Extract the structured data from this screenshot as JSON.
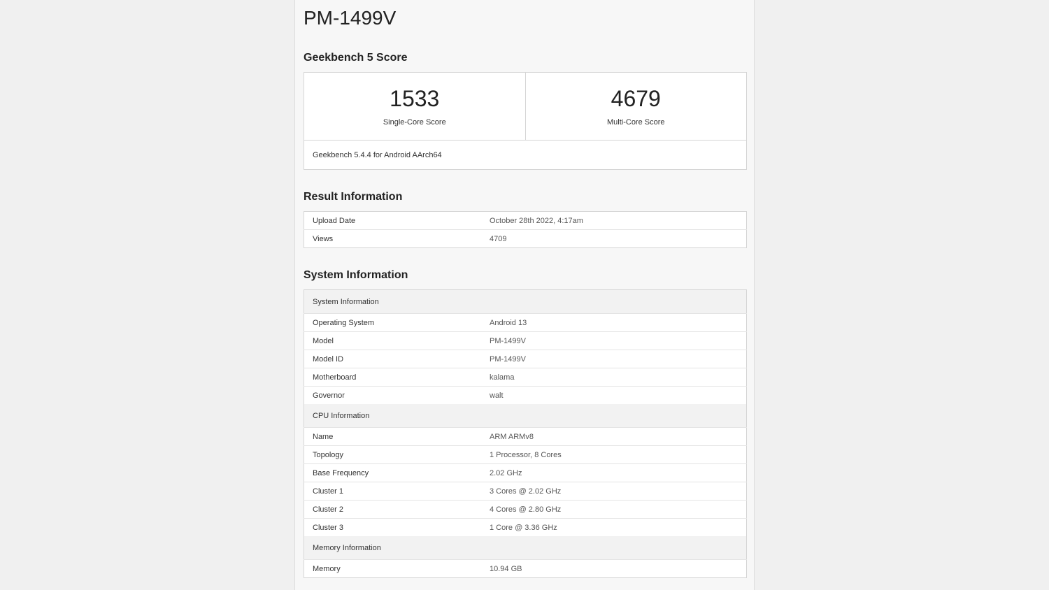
{
  "device": {
    "name": "PM-1499V"
  },
  "score_section": {
    "heading": "Geekbench 5 Score",
    "single_core": {
      "value": "1533",
      "label": "Single-Core Score"
    },
    "multi_core": {
      "value": "4679",
      "label": "Multi-Core Score"
    },
    "version": "Geekbench 5.4.4 for Android AArch64"
  },
  "result_info": {
    "heading": "Result Information",
    "rows": [
      {
        "key": "Upload Date",
        "value": "October 28th 2022, 4:17am"
      },
      {
        "key": "Views",
        "value": "4709"
      }
    ]
  },
  "system_info": {
    "heading": "System Information",
    "groups": [
      {
        "title": "System Information",
        "rows": [
          {
            "key": "Operating System",
            "value": "Android 13"
          },
          {
            "key": "Model",
            "value": "PM-1499V"
          },
          {
            "key": "Model ID",
            "value": "PM-1499V"
          },
          {
            "key": "Motherboard",
            "value": "kalama"
          },
          {
            "key": "Governor",
            "value": "walt"
          }
        ]
      },
      {
        "title": "CPU Information",
        "rows": [
          {
            "key": "Name",
            "value": "ARM ARMv8"
          },
          {
            "key": "Topology",
            "value": "1 Processor, 8 Cores"
          },
          {
            "key": "Base Frequency",
            "value": "2.02 GHz"
          },
          {
            "key": "Cluster 1",
            "value": "3 Cores @ 2.02 GHz"
          },
          {
            "key": "Cluster 2",
            "value": "4 Cores @ 2.80 GHz"
          },
          {
            "key": "Cluster 3",
            "value": "1 Core @ 3.36 GHz"
          }
        ]
      },
      {
        "title": "Memory Information",
        "rows": [
          {
            "key": "Memory",
            "value": "10.94 GB"
          }
        ]
      }
    ]
  }
}
